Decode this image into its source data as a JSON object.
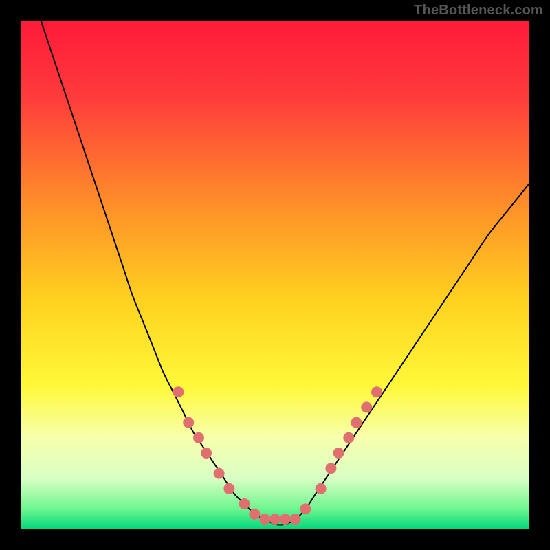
{
  "watermark": "TheBottleneck.com",
  "chart_data": {
    "type": "line",
    "title": "",
    "xlabel": "",
    "ylabel": "",
    "xlim": [
      0,
      100
    ],
    "ylim": [
      0,
      100
    ],
    "background_gradient": {
      "stops": [
        {
          "offset": 0.0,
          "color": "#ff1a3a"
        },
        {
          "offset": 0.15,
          "color": "#ff3b3b"
        },
        {
          "offset": 0.35,
          "color": "#ff8a2a"
        },
        {
          "offset": 0.55,
          "color": "#ffd21f"
        },
        {
          "offset": 0.72,
          "color": "#fff93a"
        },
        {
          "offset": 0.82,
          "color": "#f7ffad"
        },
        {
          "offset": 0.9,
          "color": "#d9ffc4"
        },
        {
          "offset": 0.96,
          "color": "#6ef58f"
        },
        {
          "offset": 1.0,
          "color": "#00d87a"
        }
      ]
    },
    "series": [
      {
        "name": "curve",
        "color": "#000000",
        "stroke_width": 2,
        "x": [
          4,
          6,
          8,
          10,
          12,
          14,
          16,
          18,
          20,
          22,
          24,
          26,
          28,
          30,
          32,
          34,
          36,
          38,
          40,
          42,
          44,
          46,
          48,
          50,
          52,
          54,
          56,
          58,
          60,
          64,
          68,
          72,
          76,
          80,
          84,
          88,
          92,
          96,
          100
        ],
        "y": [
          100,
          94,
          88,
          82,
          76,
          70,
          64,
          58,
          52,
          46,
          41,
          36,
          31,
          27,
          23,
          19,
          16,
          13,
          10,
          7,
          5,
          3,
          2,
          1,
          1,
          2,
          4,
          7,
          10,
          16,
          22,
          28,
          34,
          40,
          46,
          52,
          58,
          63,
          68
        ]
      }
    ],
    "markers": {
      "name": "dots",
      "color": "#e07070",
      "radius": 8,
      "points": [
        {
          "x": 31,
          "y": 27
        },
        {
          "x": 33,
          "y": 21
        },
        {
          "x": 35,
          "y": 18
        },
        {
          "x": 36.5,
          "y": 15
        },
        {
          "x": 39,
          "y": 11
        },
        {
          "x": 41,
          "y": 8
        },
        {
          "x": 44,
          "y": 5
        },
        {
          "x": 46,
          "y": 3
        },
        {
          "x": 48,
          "y": 2
        },
        {
          "x": 50,
          "y": 2
        },
        {
          "x": 52,
          "y": 2
        },
        {
          "x": 54,
          "y": 2
        },
        {
          "x": 56,
          "y": 4
        },
        {
          "x": 59,
          "y": 8
        },
        {
          "x": 61,
          "y": 12
        },
        {
          "x": 62.5,
          "y": 15
        },
        {
          "x": 64.5,
          "y": 18
        },
        {
          "x": 66,
          "y": 21
        },
        {
          "x": 68,
          "y": 24
        },
        {
          "x": 70,
          "y": 27
        }
      ]
    }
  }
}
